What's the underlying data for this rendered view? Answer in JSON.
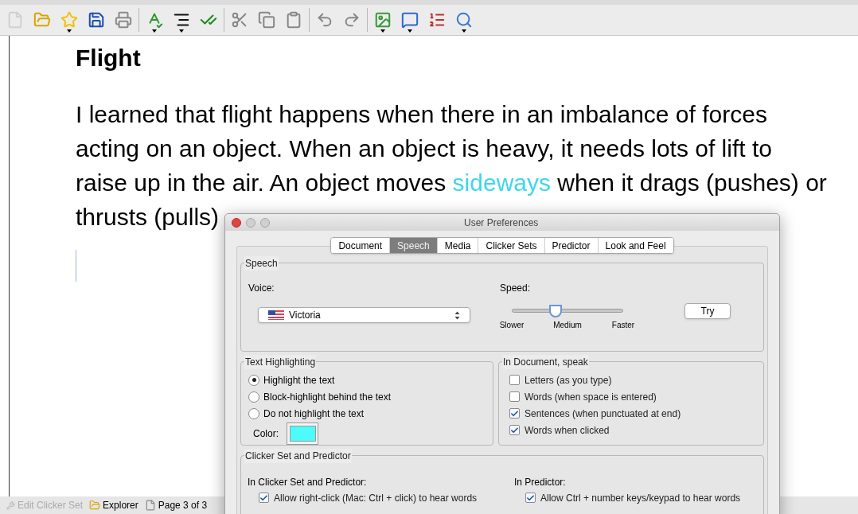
{
  "toolbar": {
    "buttons": [
      {
        "kind": "new"
      },
      {
        "kind": "open"
      },
      {
        "kind": "favorite",
        "menu": true
      },
      {
        "kind": "save"
      },
      {
        "kind": "print"
      },
      {
        "kind": "spelling",
        "menu": true
      },
      {
        "kind": "format",
        "menu": true
      },
      {
        "kind": "spellcheck"
      },
      {
        "kind": "cut"
      },
      {
        "kind": "copy"
      },
      {
        "kind": "paste"
      },
      {
        "kind": "undo"
      },
      {
        "kind": "redo"
      },
      {
        "kind": "picture",
        "menu": true
      },
      {
        "kind": "speak",
        "menu": true
      },
      {
        "kind": "list"
      },
      {
        "kind": "zoom",
        "menu": true
      }
    ]
  },
  "document": {
    "title": "Flight",
    "lines": [
      [
        {
          "text": "I learned that flight happens when there in an imbalance of forces",
          "highlighted": false
        }
      ],
      [
        {
          "text": "acting on an object.  When an object is heavy, it needs lots of lift to",
          "highlighted": false
        }
      ],
      [
        {
          "text": "raise up in the air. An object moves ",
          "highlighted": false
        },
        {
          "text": "sideways",
          "highlighted": true
        },
        {
          "text": " when it drags (pushes) or",
          "highlighted": false
        }
      ],
      [
        {
          "text": "thrusts (pulls)",
          "highlighted": false
        }
      ]
    ]
  },
  "status_bar": [
    {
      "label": "Edit Clicker Set",
      "kind": "tool",
      "disabled": true
    },
    {
      "label": "Explorer",
      "kind": "folder",
      "disabled": false
    },
    {
      "label": "Page 3 of 3",
      "kind": "page",
      "disabled": false
    }
  ],
  "dialog": {
    "title": "User Preferences",
    "tabs": [
      {
        "label": "Document",
        "selected": false
      },
      {
        "label": "Speech",
        "selected": true
      },
      {
        "label": "Media",
        "selected": false
      },
      {
        "label": "Clicker Sets",
        "selected": false
      },
      {
        "label": "Predictor",
        "selected": false
      },
      {
        "label": "Look and Feel",
        "selected": false
      }
    ],
    "speech": {
      "title": "Speech",
      "voice_label": "Voice:",
      "voice": "Victoria",
      "speed_label": "Speed:",
      "speed": {
        "level": 0.39,
        "ticks": [
          "Slower",
          "Medium",
          "Faster"
        ]
      },
      "try_button": "Try"
    },
    "text_highlighting": {
      "title": "Text Highlighting",
      "options": [
        {
          "label": "Highlight the text",
          "selected": true
        },
        {
          "label": "Block-highlight behind the text",
          "selected": false
        },
        {
          "label": "Do not highlight the text",
          "selected": false
        }
      ],
      "color_label": "Color:",
      "color": "#4dfbfb"
    },
    "in_document": {
      "title": "In Document, speak",
      "options": [
        {
          "label": "Letters (as you type)",
          "checked": false
        },
        {
          "label": "Words (when space is entered)",
          "checked": false
        },
        {
          "label": "Sentences (when punctuated at end)",
          "checked": true
        },
        {
          "label": "Words when clicked",
          "checked": true
        }
      ]
    },
    "clicker": {
      "title": "Clicker Set and Predictor",
      "columns": [
        {
          "heading": "In Clicker Set and Predictor:",
          "option": {
            "label": "Allow right-click (Mac: Ctrl + click) to hear words",
            "checked": true
          }
        },
        {
          "heading": "In Predictor:",
          "option": {
            "label": "Allow Ctrl + number keys/keypad to hear words",
            "checked": true
          }
        }
      ]
    }
  }
}
